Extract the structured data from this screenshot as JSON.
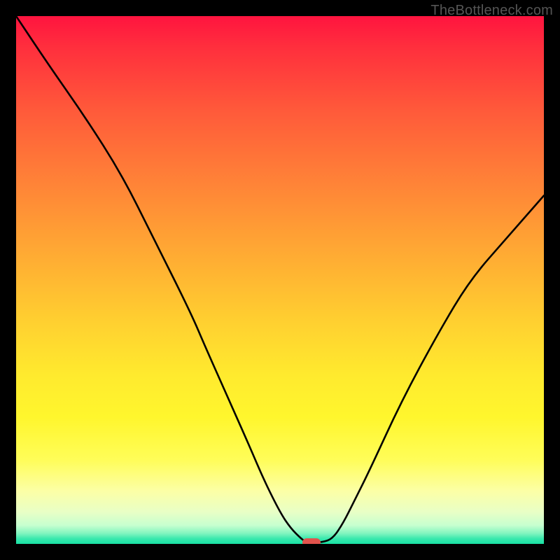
{
  "watermark": "TheBottleneck.com",
  "chart_data": {
    "type": "line",
    "title": "",
    "xlabel": "",
    "ylabel": "",
    "xlim": [
      0,
      100
    ],
    "ylim": [
      0,
      100
    ],
    "grid": false,
    "x": [
      0,
      6,
      13,
      20,
      26,
      33,
      36,
      40,
      44,
      47,
      50,
      52,
      54,
      55,
      56,
      58,
      60,
      62,
      64,
      67,
      73,
      80,
      86,
      93,
      100
    ],
    "values": [
      100,
      91,
      81,
      70,
      58,
      44,
      37,
      28,
      19,
      12,
      6,
      3,
      1,
      0.3,
      0.3,
      0.3,
      1,
      4,
      8,
      14,
      27,
      40,
      50,
      58,
      66
    ],
    "marker": {
      "x": 56,
      "y": 0.3
    }
  },
  "colors": {
    "gradient_top": "#ff143f",
    "gradient_bottom": "#18e2a4",
    "marker": "#e2534d",
    "curve": "#000000",
    "frame": "#000000"
  }
}
